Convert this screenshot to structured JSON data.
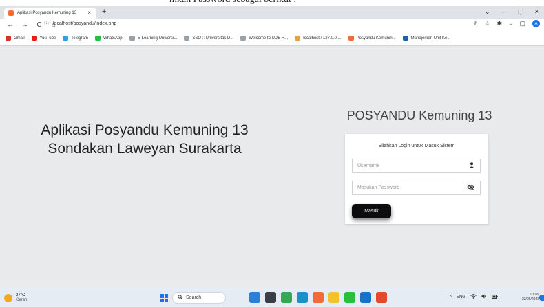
{
  "top_crop_text": "mkan Password sebagai berikut :",
  "browser": {
    "tab_title": "Aplikasi Posyandu Kemuning 13",
    "tab_close": "×",
    "new_tab": "+",
    "window_controls": [
      "⌄",
      "–",
      "▢",
      "✕"
    ],
    "url_secure_glyph": "ⓘ",
    "url": "localhost/posyandu/index.php",
    "nav": {
      "back": "←",
      "forward": "→",
      "reload": "C",
      "home": "⌂"
    },
    "toolbar_icons": [
      "⇪",
      "☆",
      "✱",
      "≡",
      "▢"
    ],
    "profile_initial": "A",
    "bookmarks": [
      {
        "label": "Gmail",
        "icon": "gmail-icon",
        "color": "#d93025"
      },
      {
        "label": "YouTube",
        "icon": "youtube-icon",
        "color": "#e62117"
      },
      {
        "label": "Telegram",
        "icon": "telegram-icon",
        "color": "#2aa3e0"
      },
      {
        "label": "WhatsApp",
        "icon": "whatsapp-icon",
        "color": "#25c03c"
      },
      {
        "label": "E-Learning Universi...",
        "icon": "site-icon",
        "color": "#9aa0a6"
      },
      {
        "label": "SSO :: Universitas D...",
        "icon": "site-icon",
        "color": "#9aa0a6"
      },
      {
        "label": "Welcome to UDB R...",
        "icon": "site-icon",
        "color": "#9aa0a6"
      },
      {
        "label": "localhost / 127.0.0....",
        "icon": "phpmyadmin-icon",
        "color": "#e8a33c"
      },
      {
        "label": "Posyandu Kemunin...",
        "icon": "posyandu-icon",
        "color": "#f26b3a"
      },
      {
        "label": "Manajemen Unit Ke...",
        "icon": "site-icon",
        "color": "#1f5fa8"
      }
    ]
  },
  "page": {
    "tagline_line1": "Aplikasi Posyandu Kemuning 13",
    "tagline_line2": "Sondakan Laweyan Surakarta",
    "brand": "POSYANDU Kemuning 13",
    "login": {
      "title": "Silahkan Login untuk Masuk Sistem",
      "username_placeholder": "Username",
      "username_icon": "user-icon",
      "password_placeholder": "Masukan Password",
      "password_icon": "eye-slash-icon",
      "submit_label": "Masuk"
    }
  },
  "taskbar": {
    "temperature": "27°C",
    "weather": "Cerah",
    "search_label": "Search",
    "apps": [
      {
        "icon": "bing-icon",
        "color": "#2a7fd6"
      },
      {
        "icon": "taskview-icon",
        "color": "#3b3f45"
      },
      {
        "icon": "chrome-icon",
        "color": "#34a853"
      },
      {
        "icon": "edge-icon",
        "color": "#1e90c8"
      },
      {
        "icon": "store-icon",
        "color": "#f26b3a"
      },
      {
        "icon": "files-icon",
        "color": "#f2c12e"
      },
      {
        "icon": "whatsapp-icon",
        "color": "#25c03c"
      },
      {
        "icon": "outlook-icon",
        "color": "#1773c7"
      },
      {
        "icon": "office-icon",
        "color": "#e24a2b"
      }
    ],
    "tray_caret": "^",
    "language": "ENG",
    "tray_icons": [
      "wifi-icon",
      "speaker-icon",
      "battery-icon"
    ],
    "time": "01:05",
    "date": "23/06/2023"
  }
}
